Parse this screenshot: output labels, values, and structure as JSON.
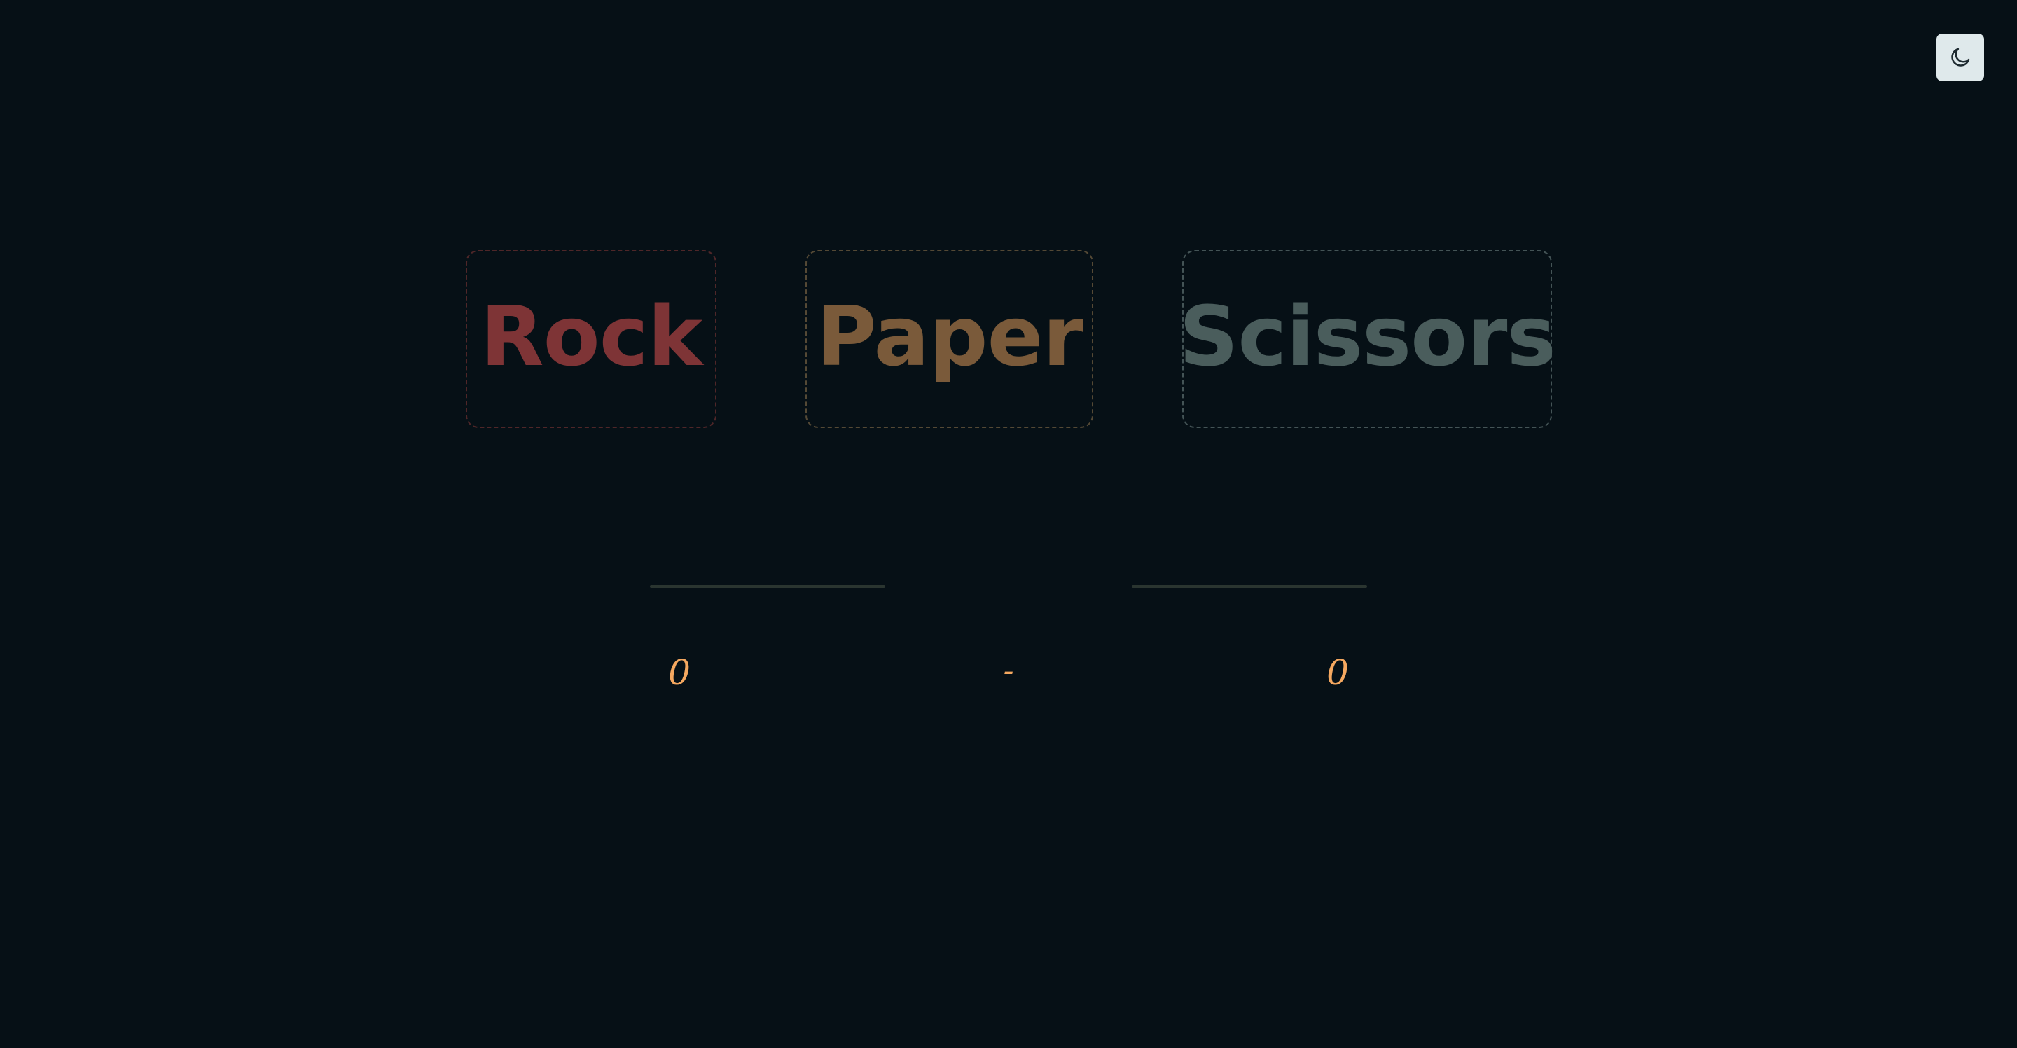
{
  "theme_toggle": {
    "icon": "moon-icon",
    "background": "#dfe9eb",
    "icon_color": "#1e2a30"
  },
  "choices": [
    {
      "label": "Rock",
      "color": "#7e3436"
    },
    {
      "label": "Paper",
      "color": "#7a5a3a"
    },
    {
      "label": "Scissors",
      "color": "#4a5d5c"
    }
  ],
  "score": {
    "player": "0",
    "separator": "-",
    "computer": "0",
    "color": "#f5a860"
  },
  "colors": {
    "background": "#061016",
    "divider": "#2a3530"
  }
}
